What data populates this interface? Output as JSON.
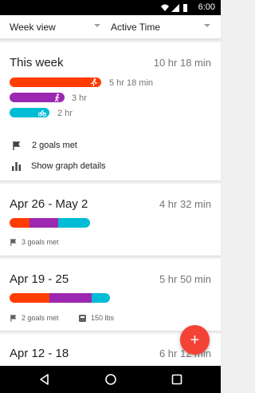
{
  "status_bar": {
    "time": "6:00"
  },
  "toolbar": {
    "view_select": "Week view",
    "metric_select": "Active Time"
  },
  "this_week": {
    "title": "This week",
    "total": "10 hr 18 min",
    "activities": [
      {
        "icon": "running-icon",
        "duration": "5 hr 18 min",
        "color": "#ff3d00"
      },
      {
        "icon": "walking-icon",
        "duration": "3 hr",
        "color": "#9c27b0"
      },
      {
        "icon": "cycling-icon",
        "duration": "2 hr",
        "color": "#00bcd4"
      }
    ],
    "goals_met": "2 goals met",
    "graph_details": "Show graph details"
  },
  "weeks": [
    {
      "title": "Apr 26 - May 2",
      "total": "4 hr 32 min",
      "goals_met": "3 goals met",
      "segments": [
        0.25,
        0.35,
        0.4
      ]
    },
    {
      "title": "Apr 19 - 25",
      "total": "5 hr 50 min",
      "goals_met": "2 goals met",
      "weight": "150 lbs",
      "segments": [
        0.4,
        0.42,
        0.18
      ]
    },
    {
      "title": "Apr 12 - 18",
      "total": "6 hr 12 min"
    }
  ],
  "fab": {
    "label": "+"
  },
  "colors": {
    "run": "#ff3d00",
    "walk": "#9c27b0",
    "bike": "#00bcd4",
    "fab": "#f44336"
  }
}
